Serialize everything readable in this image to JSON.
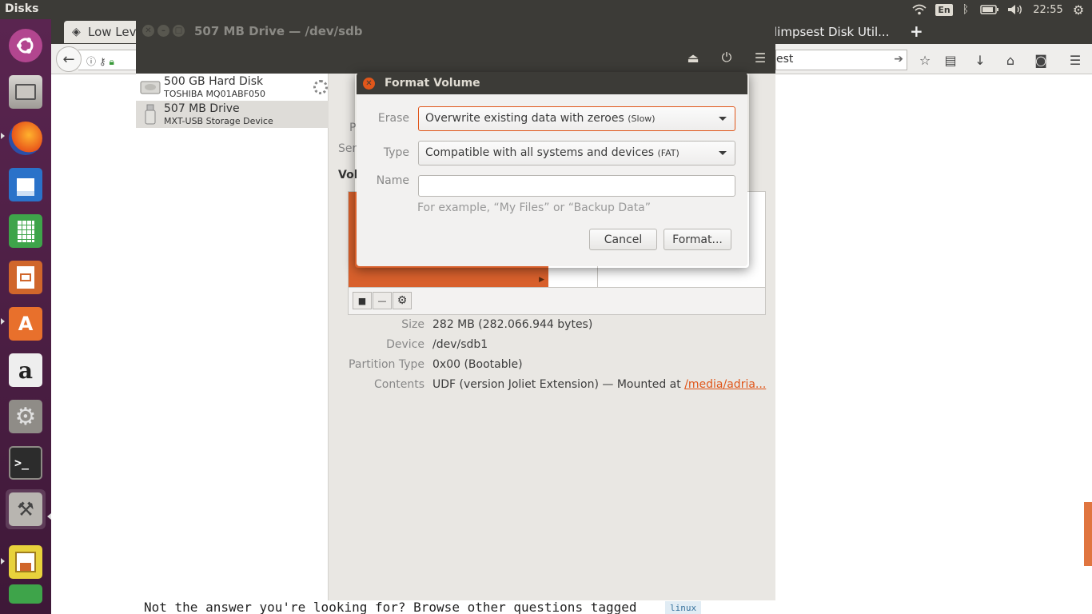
{
  "top_panel": {
    "app_title": "Disks",
    "keyboard_layout": "En",
    "clock": "22:55"
  },
  "launcher": {
    "items": [
      {
        "name": "ubuntu-dash"
      },
      {
        "name": "files"
      },
      {
        "name": "firefox"
      },
      {
        "name": "libreoffice-writer"
      },
      {
        "name": "libreoffice-calc"
      },
      {
        "name": "libreoffice-impress"
      },
      {
        "name": "ubuntu-software"
      },
      {
        "name": "amazon",
        "glyph": "a"
      },
      {
        "name": "system-settings"
      },
      {
        "name": "terminal",
        "glyph": ">_"
      },
      {
        "name": "disks"
      },
      {
        "name": "image-viewer"
      },
      {
        "name": "partially-hidden-app"
      }
    ]
  },
  "browser": {
    "tab1_title": "Low Leve",
    "tab2_title": "limpsest Disk Util...",
    "new_tab_glyph": "+",
    "searchbar_text": "est",
    "page_text": "Not the answer you're looking for? Browse other questions tagged",
    "page_tag": "linux"
  },
  "disks_window": {
    "title": "507 MB Drive — /dev/sdb",
    "drives": [
      {
        "name": "500 GB Hard Disk",
        "model": "TOSHIBA MQ01ABF050"
      },
      {
        "name": "507 MB Drive",
        "model": "MXT-USB Storage Device"
      }
    ],
    "ghost_labels": [
      "P",
      "Ser"
    ],
    "volumes_label": "Vol",
    "volume_info": {
      "size_label": "Size",
      "size_value": "282 MB (282.066.944 bytes)",
      "device_label": "Device",
      "device_value": "/dev/sdb1",
      "partition_type_label": "Partition Type",
      "partition_type_value": "0x00 (Bootable)",
      "contents_label": "Contents",
      "contents_value": "UDF (version Joliet Extension) — Mounted at ",
      "contents_link": "/media/adria..."
    }
  },
  "format_dialog": {
    "title": "Format Volume",
    "erase_label": "Erase",
    "erase_value": "Overwrite existing data with zeroes",
    "erase_note": "(Slow)",
    "type_label": "Type",
    "type_value": "Compatible with all systems and devices",
    "type_note": "(FAT)",
    "name_label": "Name",
    "name_value": "",
    "name_hint": "For example, “My Files” or “Backup Data”",
    "cancel_label": "Cancel",
    "format_label": "Format..."
  },
  "colors": {
    "accent": "#e0561a",
    "panel": "#3c3b37",
    "launcher": "#5a2550",
    "partition_fill": "#d8602c"
  }
}
